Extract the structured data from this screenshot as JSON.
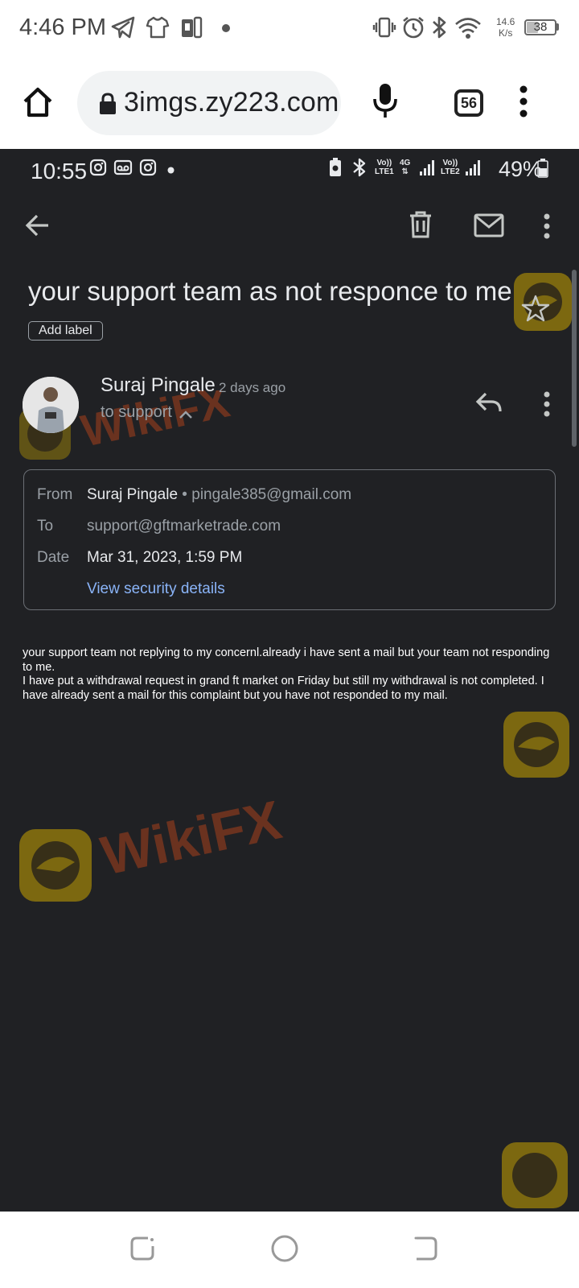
{
  "outer_status": {
    "time": "4:46 PM",
    "net_speed_value": "14.6",
    "net_speed_unit": "K/s",
    "battery": "38"
  },
  "browser": {
    "url": "3imgs.zy223.com",
    "tab_count": "56"
  },
  "inner_status": {
    "time": "10:55",
    "net1_top": "Vo))",
    "net1_bottom": "LTE1",
    "net_4g": "4G",
    "net2_top": "Vo))",
    "net2_bottom": "LTE2",
    "battery": "49%"
  },
  "email": {
    "subject": "your support team as not responce to me",
    "add_label": "Add label",
    "sender_name": "Suraj Pingale",
    "time_ago": "2 days ago",
    "recipient_summary": "to support",
    "details": {
      "from_label": "From",
      "from_name": "Suraj Pingale",
      "from_email": "pingale385@gmail.com",
      "to_label": "To",
      "to_value": "support@gftmarketrade.com",
      "date_label": "Date",
      "date_value": "Mar 31, 2023, 1:59 PM",
      "security_link": "View security details"
    },
    "body_line1": "your support team not replying to my concernl.already i have sent a mail but your team not responding to me.",
    "body_line2": "I have put a withdrawal request in grand ft market on Friday but still my withdrawal is not completed.  I have already sent a mail for this complaint but you have not responded to my mail."
  },
  "watermark": "WikiFX",
  "colors": {
    "dark_bg": "#202124",
    "text_primary": "#e8eaed",
    "text_secondary": "#9aa0a6",
    "link": "#8ab4f8",
    "watermark": "#c8a200"
  }
}
